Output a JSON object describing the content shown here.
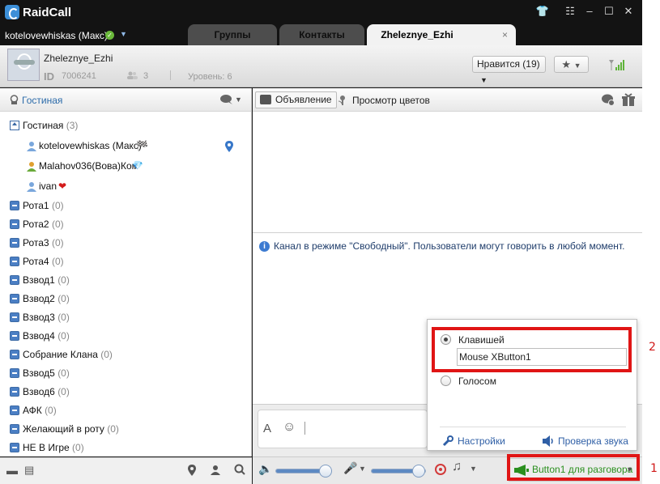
{
  "app": {
    "name": "RaidCall"
  },
  "user": {
    "name": "kotelovewhiskas (Макс)"
  },
  "tabs": [
    {
      "label": "Группы",
      "active": false
    },
    {
      "label": "Контакты",
      "active": false
    },
    {
      "label": "Zheleznye_Ezhi",
      "active": true
    }
  ],
  "tab_close": "×",
  "channel": {
    "name": "Zheleznye_Ezhi",
    "id_label": "ID",
    "id": "7006241",
    "members": "3",
    "level": "Уровень: 6",
    "like_label": "Нравится (19)"
  },
  "left": {
    "header_label": "Гостиная",
    "lobby": {
      "name": "Гостиная",
      "count": "(3)"
    },
    "users": [
      {
        "name": "kotelovewhiskas (Макс)"
      },
      {
        "name": "Malahov036(Вова)Ком"
      },
      {
        "name": "ivan"
      }
    ],
    "groups": [
      {
        "name": "Рота1",
        "count": "(0)"
      },
      {
        "name": "Рота2",
        "count": "(0)"
      },
      {
        "name": "Рота3",
        "count": "(0)"
      },
      {
        "name": "Рота4",
        "count": "(0)"
      },
      {
        "name": "Взвод1",
        "count": "(0)"
      },
      {
        "name": "Взвод2",
        "count": "(0)"
      },
      {
        "name": "Взвод3",
        "count": "(0)"
      },
      {
        "name": "Взвод4",
        "count": "(0)"
      },
      {
        "name": "Собрание Клана",
        "count": "(0)"
      },
      {
        "name": "Взвод5",
        "count": "(0)"
      },
      {
        "name": "Взвод6",
        "count": "(0)"
      },
      {
        "name": "АФК",
        "count": "(0)"
      },
      {
        "name": "Желающий в роту",
        "count": "(0)"
      },
      {
        "name": "НЕ В Игре",
        "count": "(0)"
      }
    ]
  },
  "toolbar": {
    "announcement_label": "Объявление",
    "flowers_label": "Просмотр цветов"
  },
  "chat": {
    "info_message": "Канал в режиме \"Свободный\". Пользователи могут говорить в любой момент."
  },
  "bottom": {
    "volume_level": 0.9,
    "mic_level": 0.88,
    "ptt_label": "Button1 для разговора"
  },
  "popup": {
    "option_key_label": "Клавишей",
    "key_value": "Mouse XButton1",
    "option_voice_label": "Голосом",
    "settings_label": "Настройки",
    "sound_check_label": "Проверка звука"
  },
  "annotations": {
    "label_1": "1",
    "label_2": "2"
  },
  "colors": {
    "accent": "#2f5fa6",
    "ptt_green": "#2a8f1e",
    "annotation_red": "#e01515"
  }
}
